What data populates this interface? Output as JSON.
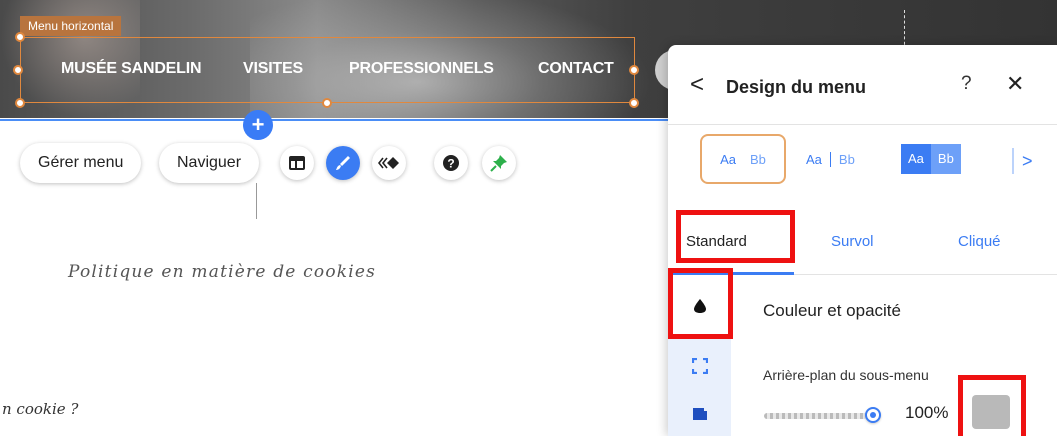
{
  "editor": {
    "menu_tag": "Menu horizontal",
    "nav_items": [
      "MUSÉE SANDELIN",
      "VISITES",
      "PROFESSIONNELS",
      "CONTACT"
    ],
    "add_symbol": "+",
    "buttons": {
      "manage_menu": "Gérer menu",
      "navigate": "Naviguer"
    },
    "tool_icons": [
      "layout-icon",
      "design-brush-icon",
      "animation-icon",
      "help-icon",
      "pin-icon"
    ],
    "page_title": "Politique en matière de cookies",
    "page_snippet": "n cookie ?"
  },
  "panel": {
    "back_symbol": "<",
    "title": "Design du menu",
    "help_symbol": "?",
    "close_symbol": "✕",
    "presets": [
      {
        "a": "Aa",
        "b": "Bb"
      },
      {
        "a": "Aa",
        "b": "Bb"
      },
      {
        "a": "Aa",
        "b": "Bb"
      }
    ],
    "scroll_symbol": ">",
    "tabs": {
      "standard": "Standard",
      "survol": "Survol",
      "clique": "Cliqué"
    },
    "section_title": "Couleur et opacité",
    "submenu_bg_label": "Arrière-plan du sous-menu",
    "opacity_value": "100%",
    "opacity_level": 1.0,
    "swatch_color": "#b9b9b9"
  },
  "colors": {
    "accent_blue": "#3b7cf3",
    "selection_orange": "#e0883e",
    "highlight_red": "#ee1111"
  }
}
